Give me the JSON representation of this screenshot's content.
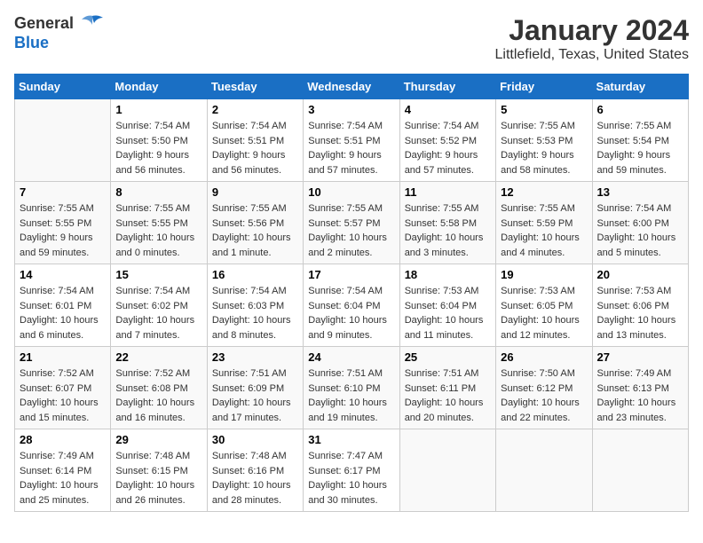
{
  "logo": {
    "line1": "General",
    "line2": "Blue"
  },
  "title": "January 2024",
  "subtitle": "Littlefield, Texas, United States",
  "weekdays": [
    "Sunday",
    "Monday",
    "Tuesday",
    "Wednesday",
    "Thursday",
    "Friday",
    "Saturday"
  ],
  "weeks": [
    [
      {
        "day": "",
        "sunrise": "",
        "sunset": "",
        "daylight": ""
      },
      {
        "day": "1",
        "sunrise": "Sunrise: 7:54 AM",
        "sunset": "Sunset: 5:50 PM",
        "daylight": "Daylight: 9 hours and 56 minutes."
      },
      {
        "day": "2",
        "sunrise": "Sunrise: 7:54 AM",
        "sunset": "Sunset: 5:51 PM",
        "daylight": "Daylight: 9 hours and 56 minutes."
      },
      {
        "day": "3",
        "sunrise": "Sunrise: 7:54 AM",
        "sunset": "Sunset: 5:51 PM",
        "daylight": "Daylight: 9 hours and 57 minutes."
      },
      {
        "day": "4",
        "sunrise": "Sunrise: 7:54 AM",
        "sunset": "Sunset: 5:52 PM",
        "daylight": "Daylight: 9 hours and 57 minutes."
      },
      {
        "day": "5",
        "sunrise": "Sunrise: 7:55 AM",
        "sunset": "Sunset: 5:53 PM",
        "daylight": "Daylight: 9 hours and 58 minutes."
      },
      {
        "day": "6",
        "sunrise": "Sunrise: 7:55 AM",
        "sunset": "Sunset: 5:54 PM",
        "daylight": "Daylight: 9 hours and 59 minutes."
      }
    ],
    [
      {
        "day": "7",
        "sunrise": "Sunrise: 7:55 AM",
        "sunset": "Sunset: 5:55 PM",
        "daylight": "Daylight: 9 hours and 59 minutes."
      },
      {
        "day": "8",
        "sunrise": "Sunrise: 7:55 AM",
        "sunset": "Sunset: 5:55 PM",
        "daylight": "Daylight: 10 hours and 0 minutes."
      },
      {
        "day": "9",
        "sunrise": "Sunrise: 7:55 AM",
        "sunset": "Sunset: 5:56 PM",
        "daylight": "Daylight: 10 hours and 1 minute."
      },
      {
        "day": "10",
        "sunrise": "Sunrise: 7:55 AM",
        "sunset": "Sunset: 5:57 PM",
        "daylight": "Daylight: 10 hours and 2 minutes."
      },
      {
        "day": "11",
        "sunrise": "Sunrise: 7:55 AM",
        "sunset": "Sunset: 5:58 PM",
        "daylight": "Daylight: 10 hours and 3 minutes."
      },
      {
        "day": "12",
        "sunrise": "Sunrise: 7:55 AM",
        "sunset": "Sunset: 5:59 PM",
        "daylight": "Daylight: 10 hours and 4 minutes."
      },
      {
        "day": "13",
        "sunrise": "Sunrise: 7:54 AM",
        "sunset": "Sunset: 6:00 PM",
        "daylight": "Daylight: 10 hours and 5 minutes."
      }
    ],
    [
      {
        "day": "14",
        "sunrise": "Sunrise: 7:54 AM",
        "sunset": "Sunset: 6:01 PM",
        "daylight": "Daylight: 10 hours and 6 minutes."
      },
      {
        "day": "15",
        "sunrise": "Sunrise: 7:54 AM",
        "sunset": "Sunset: 6:02 PM",
        "daylight": "Daylight: 10 hours and 7 minutes."
      },
      {
        "day": "16",
        "sunrise": "Sunrise: 7:54 AM",
        "sunset": "Sunset: 6:03 PM",
        "daylight": "Daylight: 10 hours and 8 minutes."
      },
      {
        "day": "17",
        "sunrise": "Sunrise: 7:54 AM",
        "sunset": "Sunset: 6:04 PM",
        "daylight": "Daylight: 10 hours and 9 minutes."
      },
      {
        "day": "18",
        "sunrise": "Sunrise: 7:53 AM",
        "sunset": "Sunset: 6:04 PM",
        "daylight": "Daylight: 10 hours and 11 minutes."
      },
      {
        "day": "19",
        "sunrise": "Sunrise: 7:53 AM",
        "sunset": "Sunset: 6:05 PM",
        "daylight": "Daylight: 10 hours and 12 minutes."
      },
      {
        "day": "20",
        "sunrise": "Sunrise: 7:53 AM",
        "sunset": "Sunset: 6:06 PM",
        "daylight": "Daylight: 10 hours and 13 minutes."
      }
    ],
    [
      {
        "day": "21",
        "sunrise": "Sunrise: 7:52 AM",
        "sunset": "Sunset: 6:07 PM",
        "daylight": "Daylight: 10 hours and 15 minutes."
      },
      {
        "day": "22",
        "sunrise": "Sunrise: 7:52 AM",
        "sunset": "Sunset: 6:08 PM",
        "daylight": "Daylight: 10 hours and 16 minutes."
      },
      {
        "day": "23",
        "sunrise": "Sunrise: 7:51 AM",
        "sunset": "Sunset: 6:09 PM",
        "daylight": "Daylight: 10 hours and 17 minutes."
      },
      {
        "day": "24",
        "sunrise": "Sunrise: 7:51 AM",
        "sunset": "Sunset: 6:10 PM",
        "daylight": "Daylight: 10 hours and 19 minutes."
      },
      {
        "day": "25",
        "sunrise": "Sunrise: 7:51 AM",
        "sunset": "Sunset: 6:11 PM",
        "daylight": "Daylight: 10 hours and 20 minutes."
      },
      {
        "day": "26",
        "sunrise": "Sunrise: 7:50 AM",
        "sunset": "Sunset: 6:12 PM",
        "daylight": "Daylight: 10 hours and 22 minutes."
      },
      {
        "day": "27",
        "sunrise": "Sunrise: 7:49 AM",
        "sunset": "Sunset: 6:13 PM",
        "daylight": "Daylight: 10 hours and 23 minutes."
      }
    ],
    [
      {
        "day": "28",
        "sunrise": "Sunrise: 7:49 AM",
        "sunset": "Sunset: 6:14 PM",
        "daylight": "Daylight: 10 hours and 25 minutes."
      },
      {
        "day": "29",
        "sunrise": "Sunrise: 7:48 AM",
        "sunset": "Sunset: 6:15 PM",
        "daylight": "Daylight: 10 hours and 26 minutes."
      },
      {
        "day": "30",
        "sunrise": "Sunrise: 7:48 AM",
        "sunset": "Sunset: 6:16 PM",
        "daylight": "Daylight: 10 hours and 28 minutes."
      },
      {
        "day": "31",
        "sunrise": "Sunrise: 7:47 AM",
        "sunset": "Sunset: 6:17 PM",
        "daylight": "Daylight: 10 hours and 30 minutes."
      },
      {
        "day": "",
        "sunrise": "",
        "sunset": "",
        "daylight": ""
      },
      {
        "day": "",
        "sunrise": "",
        "sunset": "",
        "daylight": ""
      },
      {
        "day": "",
        "sunrise": "",
        "sunset": "",
        "daylight": ""
      }
    ]
  ]
}
